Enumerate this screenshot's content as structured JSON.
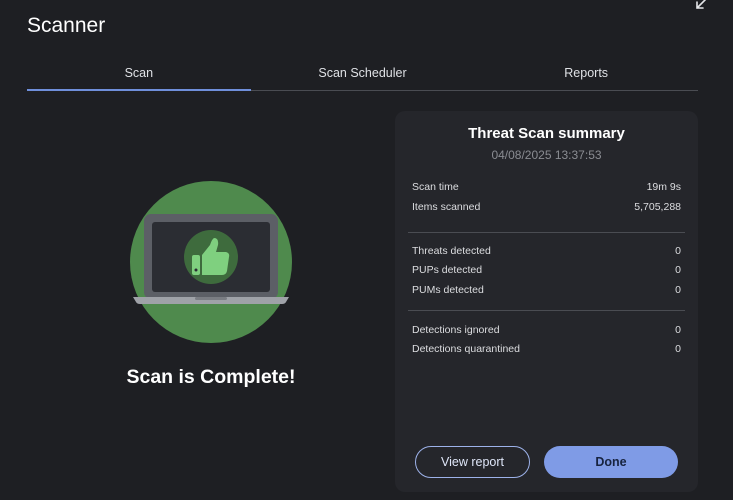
{
  "app": {
    "title": "Scanner"
  },
  "tabs": [
    {
      "label": "Scan",
      "active": true
    },
    {
      "label": "Scan Scheduler",
      "active": false
    },
    {
      "label": "Reports",
      "active": false
    }
  ],
  "result": {
    "message": "Scan is Complete!"
  },
  "summary": {
    "title": "Threat Scan summary",
    "date": "04/08/2025 13:37:53",
    "rows": [
      {
        "label": "Scan time",
        "value": "19m 9s"
      },
      {
        "label": "Items scanned",
        "value": "5,705,288"
      },
      {
        "label": "Threats detected",
        "value": "0"
      },
      {
        "label": "PUPs detected",
        "value": "0"
      },
      {
        "label": "PUMs detected",
        "value": "0"
      },
      {
        "label": "Detections ignored",
        "value": "0"
      },
      {
        "label": "Detections quarantined",
        "value": "0"
      }
    ]
  },
  "buttons": {
    "view_report": "View report",
    "done": "Done"
  },
  "colors": {
    "accent": "#7f9be6",
    "tab_indicator": "#6f8fdb",
    "success_green": "#4f8a4d",
    "thumb_green": "#7fd07f",
    "background": "#1e1f23",
    "panel": "#25262b"
  },
  "icons": [
    "collapse-arrow-icon",
    "laptop-icon",
    "thumbs-up-icon"
  ]
}
